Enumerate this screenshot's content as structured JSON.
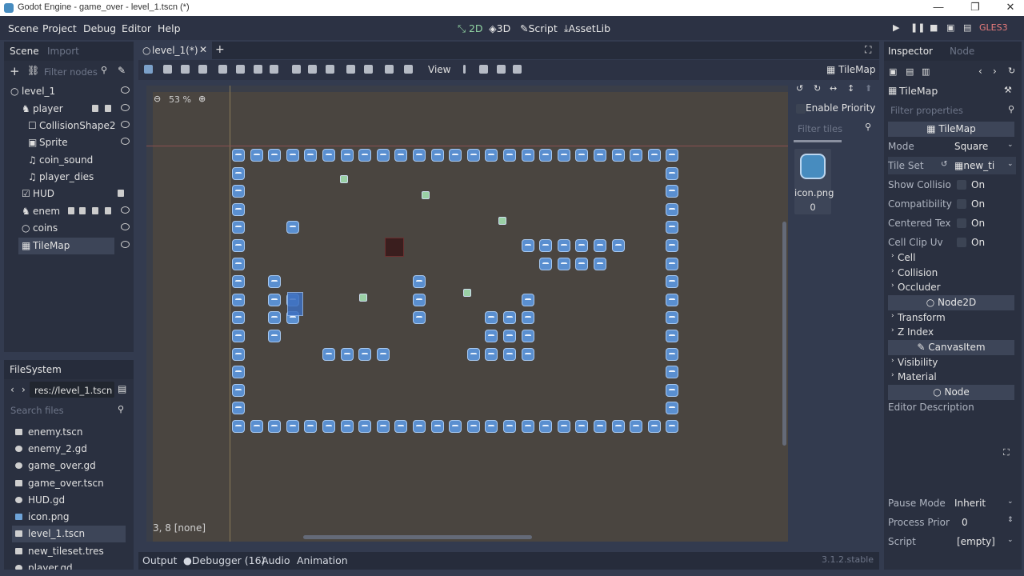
{
  "window": {
    "title": "Godot Engine - game_over - level_1.tscn (*)",
    "min": "—",
    "max": "❐",
    "close": "✕"
  },
  "menus": [
    "Scene",
    "Project",
    "Debug",
    "Editor",
    "Help"
  ],
  "workspaces": {
    "w2d": "2D",
    "w3d": "3D",
    "script": "Script",
    "assetlib": "AssetLib"
  },
  "renderer": "GLES3",
  "scene_dock": {
    "tab_scene": "Scene",
    "tab_import": "Import",
    "filter_placeholder": "Filter nodes",
    "nodes": [
      {
        "label": "level_1"
      },
      {
        "label": "player"
      },
      {
        "label": "CollisionShape2"
      },
      {
        "label": "Sprite"
      },
      {
        "label": "coin_sound"
      },
      {
        "label": "player_dies"
      },
      {
        "label": "HUD"
      },
      {
        "label": "enem"
      },
      {
        "label": "coins"
      },
      {
        "label": "TileMap"
      }
    ]
  },
  "filesystem": {
    "title": "FileSystem",
    "path": "res://level_1.tscn",
    "search_placeholder": "Search files",
    "files": [
      {
        "label": "enemy.tscn"
      },
      {
        "label": "enemy_2.gd"
      },
      {
        "label": "game_over.gd"
      },
      {
        "label": "game_over.tscn"
      },
      {
        "label": "HUD.gd"
      },
      {
        "label": "icon.png"
      },
      {
        "label": "level_1.tscn"
      },
      {
        "label": "new_tileset.tres"
      },
      {
        "label": "player.gd"
      }
    ]
  },
  "editor": {
    "tab_label": "level_1(*)",
    "view_menu": "View",
    "zoom": "53 %",
    "tilemap_label": "TileMap",
    "cell_status": "3, 8 [none]",
    "enable_priority": "Enable Priority",
    "filter_tiles_placeholder": "Filter tiles",
    "tile_item": "icon.png 0"
  },
  "inspector": {
    "tab_inspector": "Inspector",
    "tab_node": "Node",
    "node_name": "TileMap",
    "filter_placeholder": "Filter properties",
    "class_header": "TileMap",
    "props": [
      {
        "key": "Mode",
        "value": "Square"
      },
      {
        "key": "Tile Set",
        "value": "new_ti"
      },
      {
        "key": "Show Collisio",
        "value": "On"
      },
      {
        "key": "Compatibility",
        "value": "On"
      },
      {
        "key": "Centered Tex",
        "value": "On"
      },
      {
        "key": "Cell Clip Uv",
        "value": "On"
      }
    ],
    "sections1": [
      "Cell",
      "Collision",
      "Occluder"
    ],
    "node2d_header": "Node2D",
    "sections2": [
      "Transform",
      "Z Index"
    ],
    "canvasitem_header": "CanvasItem",
    "sections3": [
      "Visibility",
      "Material"
    ],
    "node_header": "Node",
    "editor_description": "Editor Description",
    "pause_mode": {
      "key": "Pause Mode",
      "value": "Inherit"
    },
    "process_priority": {
      "key": "Process Prior",
      "value": "0"
    },
    "script": {
      "key": "Script",
      "value": "[empty]"
    }
  },
  "bottom_panel": {
    "output": "Output",
    "debugger": "Debugger (16)",
    "audio": "Audio",
    "animation": "Animation",
    "version": "3.1.2.stable"
  },
  "colors": {
    "accent": "#478cbf",
    "tile": "#5a8fd0",
    "bg": "#333b4f"
  }
}
